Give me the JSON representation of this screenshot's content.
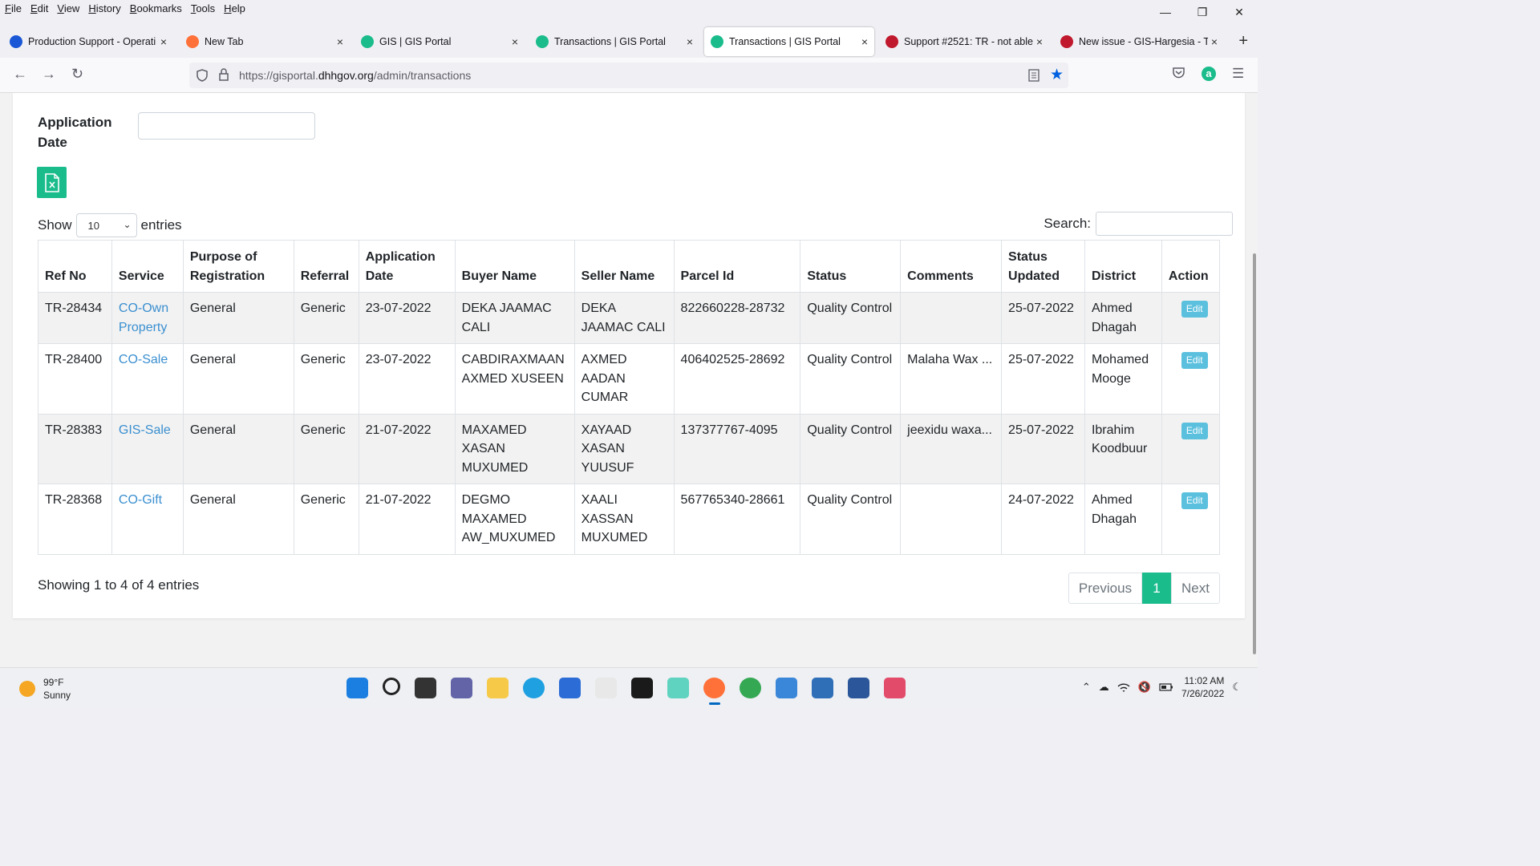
{
  "menu": [
    "File",
    "Edit",
    "View",
    "History",
    "Bookmarks",
    "Tools",
    "Help"
  ],
  "window_controls": {
    "minimize": "—",
    "restore": "❐",
    "close": "✕"
  },
  "tabs": [
    {
      "title": "Production Support - Operati",
      "favicon_color": "#1a57d6"
    },
    {
      "title": "New Tab",
      "favicon_color": "#ff7139"
    },
    {
      "title": "GIS | GIS Portal",
      "favicon_color": "#1bbc8c"
    },
    {
      "title": "Transactions | GIS Portal",
      "favicon_color": "#1bbc8c"
    },
    {
      "title": "Transactions | GIS Portal",
      "favicon_color": "#1bbc8c"
    },
    {
      "title": "Support #2521: TR - not able",
      "favicon_color": "#c0182c"
    },
    {
      "title": "New issue - GIS-Hargesia - Te",
      "favicon_color": "#c0182c"
    }
  ],
  "tab_close": "×",
  "new_tab": "+",
  "nav": {
    "url_prefix": "https://gisportal.",
    "url_domain": "dhhgov.org",
    "url_path": "/admin/transactions"
  },
  "filters": {
    "application_date_label": "Application Date"
  },
  "table_controls": {
    "show_label": "Show",
    "entries_value": "10",
    "entries_label": "entries",
    "search_label": "Search:"
  },
  "table": {
    "headers": [
      "Ref No",
      "Service",
      "Purpose of Registration",
      "Referral",
      "Application Date",
      "Buyer Name",
      "Seller Name",
      "Parcel Id",
      "Status",
      "Comments",
      "Status Updated",
      "District",
      "Action"
    ],
    "rows": [
      {
        "ref": "TR-28434",
        "service": "CO-Own Property",
        "purpose": "General",
        "referral": "Generic",
        "app_date": "23-07-2022",
        "buyer": "DEKA JAAMAC CALI",
        "seller": "DEKA JAAMAC CALI",
        "parcel": "822660228-28732",
        "status": "Quality Control",
        "comments": "",
        "updated": "25-07-2022",
        "district": "Ahmed Dhagah",
        "action": "Edit"
      },
      {
        "ref": "TR-28400",
        "service": "CO-Sale",
        "purpose": "General",
        "referral": "Generic",
        "app_date": "23-07-2022",
        "buyer": "CABDIRAXMAAN AXMED XUSEEN",
        "seller": "AXMED AADAN CUMAR",
        "parcel": "406402525-28692",
        "status": "Quality Control",
        "comments": "Malaha Wax ...",
        "updated": "25-07-2022",
        "district": "Mohamed Mooge",
        "action": "Edit"
      },
      {
        "ref": "TR-28383",
        "service": "GIS-Sale",
        "purpose": "General",
        "referral": "Generic",
        "app_date": "21-07-2022",
        "buyer": "MAXAMED XASAN MUXUMED",
        "seller": "XAYAAD XASAN YUUSUF",
        "parcel": "137377767-4095",
        "status": "Quality Control",
        "comments": "jeexidu waxa...",
        "updated": "25-07-2022",
        "district": "Ibrahim Koodbuur",
        "action": "Edit"
      },
      {
        "ref": "TR-28368",
        "service": "CO-Gift",
        "purpose": "General",
        "referral": "Generic",
        "app_date": "21-07-2022",
        "buyer": "DEGMO MAXAMED AW_MUXUMED",
        "seller": "XAALI XASSAN MUXUMED",
        "parcel": "567765340-28661",
        "status": "Quality Control",
        "comments": "",
        "updated": "24-07-2022",
        "district": "Ahmed Dhagah",
        "action": "Edit"
      }
    ]
  },
  "footer": {
    "showing": "Showing 1 to 4 of 4 entries",
    "prev": "Previous",
    "current_page": "1",
    "next": "Next"
  },
  "taskbar": {
    "temperature": "99°F",
    "condition": "Sunny",
    "time": "11:02 AM",
    "date": "7/26/2022",
    "apps": [
      {
        "name": "windows-start-icon",
        "color": "#1a7fe0"
      },
      {
        "name": "search-icon",
        "color": "transparent"
      },
      {
        "name": "task-view-icon",
        "color": "#333"
      },
      {
        "name": "teams-chat-icon",
        "color": "#6264a7"
      },
      {
        "name": "file-explorer-icon",
        "color": "#f7c948"
      },
      {
        "name": "edge-icon",
        "color": "#1fa0e0"
      },
      {
        "name": "store-icon",
        "color": "#2b6cd6"
      },
      {
        "name": "amazon-icon",
        "color": "#e8e8e8"
      },
      {
        "name": "dropbox-icon",
        "color": "#1a1a1a"
      },
      {
        "name": "messaging-icon",
        "color": "#5fd3c0"
      },
      {
        "name": "firefox-icon",
        "color": "#ff7139"
      },
      {
        "name": "chrome-icon",
        "color": "#34a853"
      },
      {
        "name": "notepad-icon",
        "color": "#3a86d8"
      },
      {
        "name": "photos-icon",
        "color": "#2f6fb8"
      },
      {
        "name": "word-icon",
        "color": "#2b579a"
      },
      {
        "name": "snipping-tool-icon",
        "color": "#e24c6a"
      }
    ]
  }
}
